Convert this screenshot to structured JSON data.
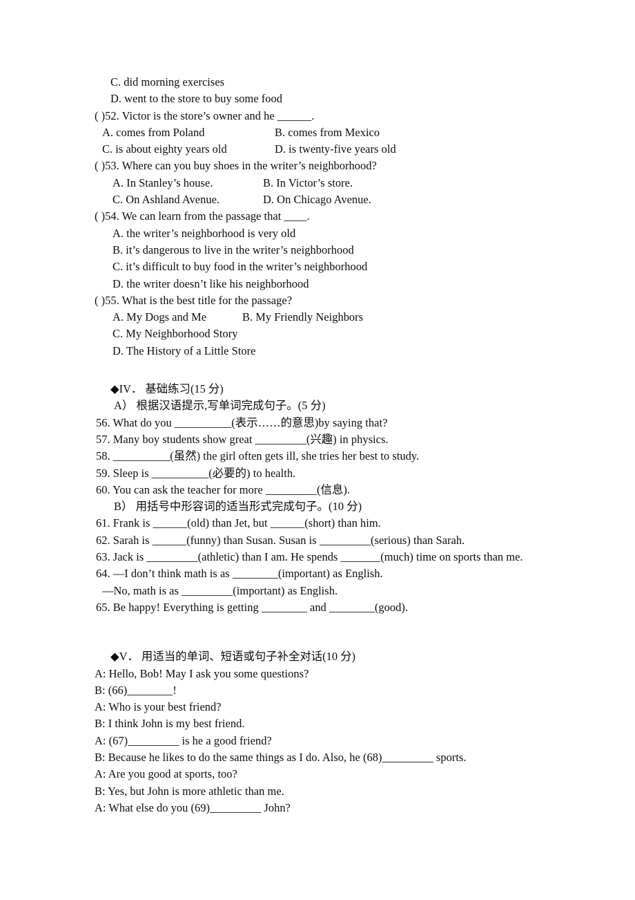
{
  "document": {
    "type": "english-exam-worksheet",
    "language": "en-zh"
  },
  "reading_options_continued": [
    {
      "id": "q51-c",
      "text": "C. did morning exercises"
    },
    {
      "id": "q51-d",
      "text": "D. went to the store to buy some food"
    }
  ],
  "questions": [
    {
      "number": "52",
      "stem": "( )52. Victor is the store’s owner and he ______.",
      "rows": [
        {
          "left": "A. comes from Poland",
          "right": "B. comes from Mexico",
          "gap": 42
        },
        {
          "left": "C. is about eighty years old",
          "right": "D. is twenty-five years old",
          "gap": 20
        }
      ],
      "indent": "ind-opt1"
    },
    {
      "number": "53",
      "stem": "( )53. Where can you buy shoes in the writer’s neighborhood?",
      "rows": [
        {
          "left": "A. In Stanley’s house.",
          "right": "B. In Victor’s store.",
          "gap": 38
        },
        {
          "left": "C. On Ashland Avenue.",
          "right": "D. On Chicago Avenue.",
          "gap": 36
        }
      ],
      "indent": "ind-opt2"
    },
    {
      "number": "54",
      "stem": "( )54. We can learn from the passage that ____.",
      "options": [
        "A. the writer’s neighborhood is very old",
        "B. it’s dangerous to live in the writer’s neighborhood",
        "C. it’s difficult to buy food in the writer’s neighborhood",
        "D. the writer doesn’t like his neighborhood"
      ],
      "indent": "ind-opt2"
    },
    {
      "number": "55",
      "stem": "( )55. What is the best title for the passage?",
      "rows": [
        {
          "left": "A. My Dogs and Me",
          "right": "B. My Friendly Neighbors",
          "gap": 34
        }
      ],
      "options_after": [
        "C. My Neighborhood Story",
        "D. The History of a Little Store"
      ],
      "indent": "ind-opt2"
    }
  ],
  "section_iv": {
    "heading": "◆IV． 基础练习(15 分)",
    "part_a": {
      "heading": "A） 根据汉语提示,写单词完成句子。(5 分)",
      "items": [
        "56. What do you __________(表示……的意思)by saying that?",
        "57. Many boy students show great _________(兴趣) in physics.",
        "58. __________(虽然) the girl often gets ill, she tries her best to study.",
        "59. Sleep is __________(必要的) to health.",
        "60. You can ask the teacher for more _________(信息)."
      ]
    },
    "part_b": {
      "heading": "B） 用括号中形容词的适当形式完成句子。(10 分)",
      "items": [
        "61. Frank is ______(old) than Jet, but ______(short) than him.",
        "62. Sarah is ______(funny) than Susan. Susan is _________(serious) than Sarah.",
        "63. Jack is _________(athletic) than I am. He spends _______(much) time on sports than me.",
        "64. —I don’t think math is as ________(important) as English."
      ],
      "item_64_continuation": "—No, math is as _________(important) as English.",
      "item_65": "65. Be happy! Everything is getting ________ and ________(good)."
    }
  },
  "section_v": {
    "heading": "◆V． 用适当的单词、短语或句子补全对话(10 分)",
    "dialogue": [
      "A: Hello, Bob! May I ask you some questions?",
      "B: (66)________!",
      "A: Who is your best friend?",
      "B: I think John is my best friend.",
      "A: (67)_________ is he a good friend?",
      "B: Because he likes to do the same things as I do. Also, he (68)_________ sports.",
      "A: Are you good at sports, too?",
      "B: Yes, but John is more athletic than me.",
      "A: What else do you (69)_________ John?"
    ]
  }
}
